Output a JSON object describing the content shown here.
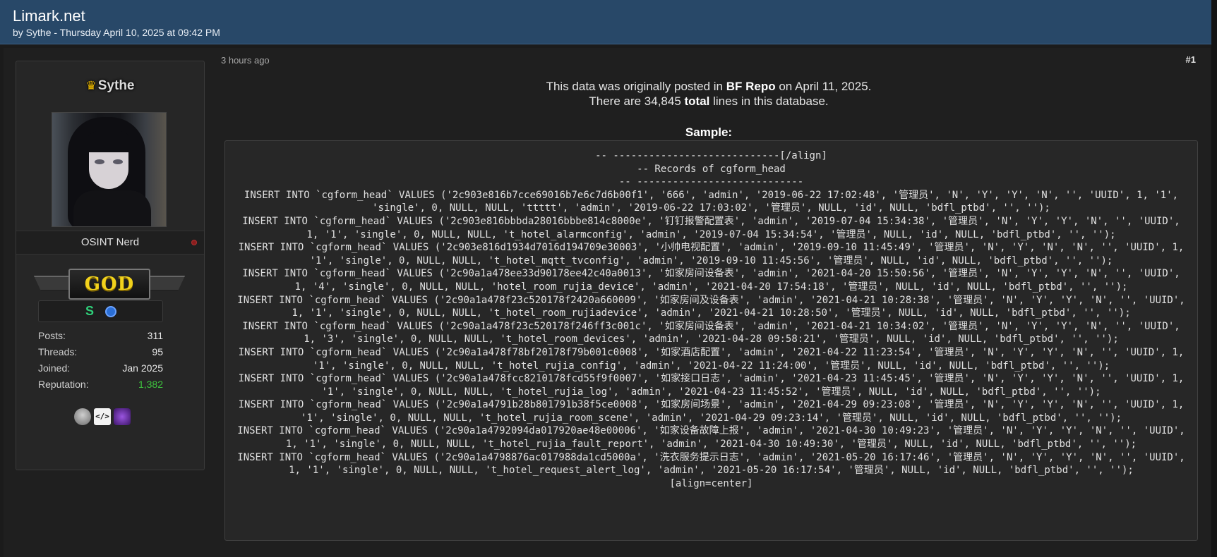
{
  "header": {
    "title": "Limark.net",
    "byline": "by Sythe - Thursday April 10, 2025 at 09:42 PM"
  },
  "user": {
    "crown_icon": "crown-icon",
    "name": "Sythe",
    "title": "OSINT Nerd",
    "rank_badge": "GOD",
    "icon_s": "S",
    "stats": [
      {
        "label": "Posts:",
        "value": "311"
      },
      {
        "label": "Threads:",
        "value": "95"
      },
      {
        "label": "Joined:",
        "value": "Jan 2025"
      },
      {
        "label": "Reputation:",
        "value": "1,382"
      }
    ],
    "award_code": "</>"
  },
  "post": {
    "timestamp": "3 hours ago",
    "number": "#1",
    "intro_line1_a": "This data was originally posted in ",
    "intro_line1_bold": "BF Repo",
    "intro_line1_b": " on April 11, 2025.",
    "intro_line2_a": "There are 34,845 ",
    "intro_line2_bold": "total",
    "intro_line2_b": " lines in this database.",
    "sample_heading": "Sample:",
    "code_lines": [
      "-- ----------------------------[/align]",
      "-- Records of cgform_head",
      "-- ----------------------------",
      "INSERT INTO `cgform_head` VALUES ('2c903e816b7cce69016b7e6c7d6b00f1', '666', 'admin', '2019-06-22 17:02:48', '管理员', 'N', 'Y', 'Y', 'N', '', 'UUID', 1, '1', 'single', 0, NULL, NULL, 'ttttt', 'admin', '2019-06-22 17:03:02', '管理员', NULL, 'id', NULL, 'bdfl_ptbd', '', '');",
      "INSERT INTO `cgform_head` VALUES ('2c903e816bbbda28016bbbe814c8000e', '钉钉报警配置表', 'admin', '2019-07-04 15:34:38', '管理员', 'N', 'Y', 'Y', 'N', '', 'UUID', 1, '1', 'single', 0, NULL, NULL, 't_hotel_alarmconfig', 'admin', '2019-07-04 15:34:54', '管理员', NULL, 'id', NULL, 'bdfl_ptbd', '', '');",
      "INSERT INTO `cgform_head` VALUES ('2c903e816d1934d7016d194709e30003', '小帅电视配置', 'admin', '2019-09-10 11:45:49', '管理员', 'N', 'Y', 'N', 'N', '', 'UUID', 1, '1', 'single', 0, NULL, NULL, 't_hotel_mqtt_tvconfig', 'admin', '2019-09-10 11:45:56', '管理员', NULL, 'id', NULL, 'bdfl_ptbd', '', '');",
      "INSERT INTO `cgform_head` VALUES ('2c90a1a478ee33d90178ee42c40a0013', '如家房间设备表', 'admin', '2021-04-20 15:50:56', '管理员', 'N', 'Y', 'Y', 'N', '', 'UUID', 1, '4', 'single', 0, NULL, NULL, 'hotel_room_rujia_device', 'admin', '2021-04-20 17:54:18', '管理员', NULL, 'id', NULL, 'bdfl_ptbd', '', '');",
      "INSERT INTO `cgform_head` VALUES ('2c90a1a478f23c520178f2420a660009', '如家房间及设备表', 'admin', '2021-04-21 10:28:38', '管理员', 'N', 'Y', 'Y', 'N', '', 'UUID', 1, '1', 'single', 0, NULL, NULL, 't_hotel_room_rujiadevice', 'admin', '2021-04-21 10:28:50', '管理员', NULL, 'id', NULL, 'bdfl_ptbd', '', '');",
      "INSERT INTO `cgform_head` VALUES ('2c90a1a478f23c520178f246ff3c001c', '如家房间设备表', 'admin', '2021-04-21 10:34:02', '管理员', 'N', 'Y', 'Y', 'N', '', 'UUID', 1, '3', 'single', 0, NULL, NULL, 't_hotel_room_devices', 'admin', '2021-04-28 09:58:21', '管理员', NULL, 'id', NULL, 'bdfl_ptbd', '', '');",
      "INSERT INTO `cgform_head` VALUES ('2c90a1a478f78bf20178f79b001c0008', '如家酒店配置', 'admin', '2021-04-22 11:23:54', '管理员', 'N', 'Y', 'Y', 'N', '', 'UUID', 1, '1', 'single', 0, NULL, NULL, 't_hotel_rujia_config', 'admin', '2021-04-22 11:24:00', '管理员', NULL, 'id', NULL, 'bdfl_ptbd', '', '');",
      "INSERT INTO `cgform_head` VALUES ('2c90a1a478fcc8210178fcd55f9f0007', '如家接口日志', 'admin', '2021-04-23 11:45:45', '管理员', 'N', 'Y', 'Y', 'N', '', 'UUID', 1, '1', 'single', 0, NULL, NULL, 't_hotel_rujia_log', 'admin', '2021-04-23 11:45:52', '管理员', NULL, 'id', NULL, 'bdfl_ptbd', '', '');",
      "INSERT INTO `cgform_head` VALUES ('2c90a1a4791b28b801791b38f5ce0008', '如家房间场景', 'admin', '2021-04-29 09:23:08', '管理员', 'N', 'Y', 'Y', 'N', '', 'UUID', 1, '1', 'single', 0, NULL, NULL, 't_hotel_rujia_room_scene', 'admin', '2021-04-29 09:23:14', '管理员', NULL, 'id', NULL, 'bdfl_ptbd', '', '');",
      "INSERT INTO `cgform_head` VALUES ('2c90a1a4792094da017920ae48e00006', '如家设备故障上报', 'admin', '2021-04-30 10:49:23', '管理员', 'N', 'Y', 'Y', 'N', '', 'UUID', 1, '1', 'single', 0, NULL, NULL, 't_hotel_rujia_fault_report', 'admin', '2021-04-30 10:49:30', '管理员', NULL, 'id', NULL, 'bdfl_ptbd', '', '');",
      "INSERT INTO `cgform_head` VALUES ('2c90a1a4798876ac017988da1cd5000a', '洗衣服务提示日志', 'admin', '2021-05-20 16:17:46', '管理员', 'N', 'Y', 'Y', 'N', '', 'UUID', 1, '1', 'single', 0, NULL, NULL, 't_hotel_request_alert_log', 'admin', '2021-05-20 16:17:54', '管理员', NULL, 'id', NULL, 'bdfl_ptbd', '', '');",
      "[align=center]"
    ]
  },
  "colors": {
    "header_bg": "#284868",
    "page_bg": "#1b1b1b",
    "reputation": "#3ec43e",
    "rank_gold": "#f2d21c"
  }
}
